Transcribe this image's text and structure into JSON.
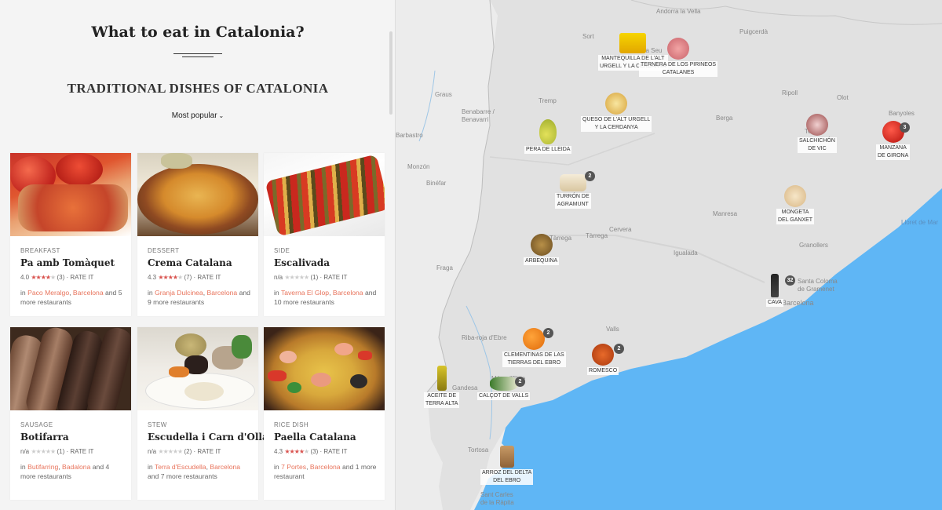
{
  "page": {
    "title": "What to eat in Catalonia?",
    "section_heading": "TRADITIONAL DISHES OF CATALONIA",
    "sort_label": "Most popular"
  },
  "dishes": [
    {
      "category": "BREAKFAST",
      "name": "Pa amb Tomàquet",
      "score": "4.0",
      "stars_on": "★★★★",
      "stars_off": "★",
      "votes": "(3)",
      "rate": "RATE IT",
      "in": "in",
      "place1": "Paco Meralgo",
      "sep": ",",
      "city": "Barcelona",
      "more": "and 5 more restaurants"
    },
    {
      "category": "DESSERT",
      "name": "Crema Catalana",
      "score": "4.3",
      "stars_on": "★★★★",
      "stars_off": "★",
      "votes": "(7)",
      "rate": "RATE IT",
      "in": "in",
      "place1": "Granja Dulcinea",
      "sep": ",",
      "city": "Barcelona",
      "more": "and 9 more restaurants"
    },
    {
      "category": "SIDE",
      "name": "Escalivada",
      "score": "n/a",
      "stars_on": "",
      "stars_off": "★★★★★",
      "votes": "(1)",
      "rate": "RATE IT",
      "in": "in",
      "place1": "Taverna El Glop",
      "sep": ",",
      "city": "Barcelona",
      "more": "and 10 more restaurants"
    },
    {
      "category": "SAUSAGE",
      "name": "Botifarra",
      "score": "n/a",
      "stars_on": "",
      "stars_off": "★★★★★",
      "votes": "(1)",
      "rate": "RATE IT",
      "in": "in",
      "place1": "Butifarring",
      "sep": ",",
      "city": "Badalona",
      "more": "and 4 more restaurants"
    },
    {
      "category": "STEW",
      "name": "Escudella i Carn d'Olla",
      "score": "n/a",
      "stars_on": "",
      "stars_off": "★★★★★",
      "votes": "(2)",
      "rate": "RATE IT",
      "in": "in",
      "place1": "Terra d'Escudella",
      "sep": ",",
      "city": "Barcelona",
      "more": "and 7 more restaurants"
    },
    {
      "category": "RICE DISH",
      "name": "Paella Catalana",
      "score": "4.3",
      "stars_on": "★★★★",
      "stars_off": "★",
      "votes": "(3)",
      "rate": "RATE IT",
      "in": "in",
      "place1": "7 Portes",
      "sep": ",",
      "city": "Barcelona",
      "more": "and 1 more restaurant"
    }
  ],
  "map_places": [
    "Andorra la Vella",
    "Sort",
    "La Seu",
    "Puigcerdà",
    "Graus",
    "Tremp",
    "Benabarre / Benavarri",
    "Barbastro",
    "Monzón",
    "Binéfar",
    "Berga",
    "Ripoll",
    "Olot",
    "Banyoles",
    "Manresa",
    "Cervera",
    "Tàrrega",
    "Tàrrega",
    "Igualada",
    "Granollers",
    "Fraga",
    "Valls",
    "Riba-roja d'Ebre",
    "Gandesa",
    "Móra d'Ebre",
    "Tortosa",
    "Sant Carles de la Ràpita",
    "Santa Coloma de Gramenet",
    "Barcelona",
    "Lloret de Mar",
    "Torelló"
  ],
  "map_markers": [
    {
      "label": "MANTEQUILLA DE L'ALT\nURGELL Y LA CERDANYA",
      "count": ""
    },
    {
      "label": "TERNERA DE LOS PIRINEOS\nCATALANES",
      "count": ""
    },
    {
      "label": "QUESO DE L'ALT URGELL\nY LA CERDANYA",
      "count": ""
    },
    {
      "label": "PERA DE LLEIDA",
      "count": ""
    },
    {
      "label": "SALCHICHÓN\nDE VIC",
      "count": ""
    },
    {
      "label": "MANZANA\nDE GIRONA",
      "count": "3"
    },
    {
      "label": "TURRÓN DE\nAGRAMUNT",
      "count": "2"
    },
    {
      "label": "MONGETA\nDEL GANXET",
      "count": ""
    },
    {
      "label": "ARBEQUINA",
      "count": ""
    },
    {
      "label": "CAVA",
      "count": "32"
    },
    {
      "label": "CLEMENTINAS DE LAS\nTIERRAS DEL EBRO",
      "count": "2"
    },
    {
      "label": "ROMESCO",
      "count": "2"
    },
    {
      "label": "ACEITE DE\nTERRA ALTA",
      "count": ""
    },
    {
      "label": "CALÇOT DE VALLS",
      "count": "2"
    },
    {
      "label": "ARROZ DEL DELTA\nDEL EBRO",
      "count": ""
    }
  ],
  "colors": {
    "accent_link": "#e8735b",
    "star_on": "#d9534f",
    "sea": "#5fb6f5",
    "land": "#e3e3e3"
  },
  "icons": [
    "chevron-down-icon",
    "star-icon"
  ]
}
